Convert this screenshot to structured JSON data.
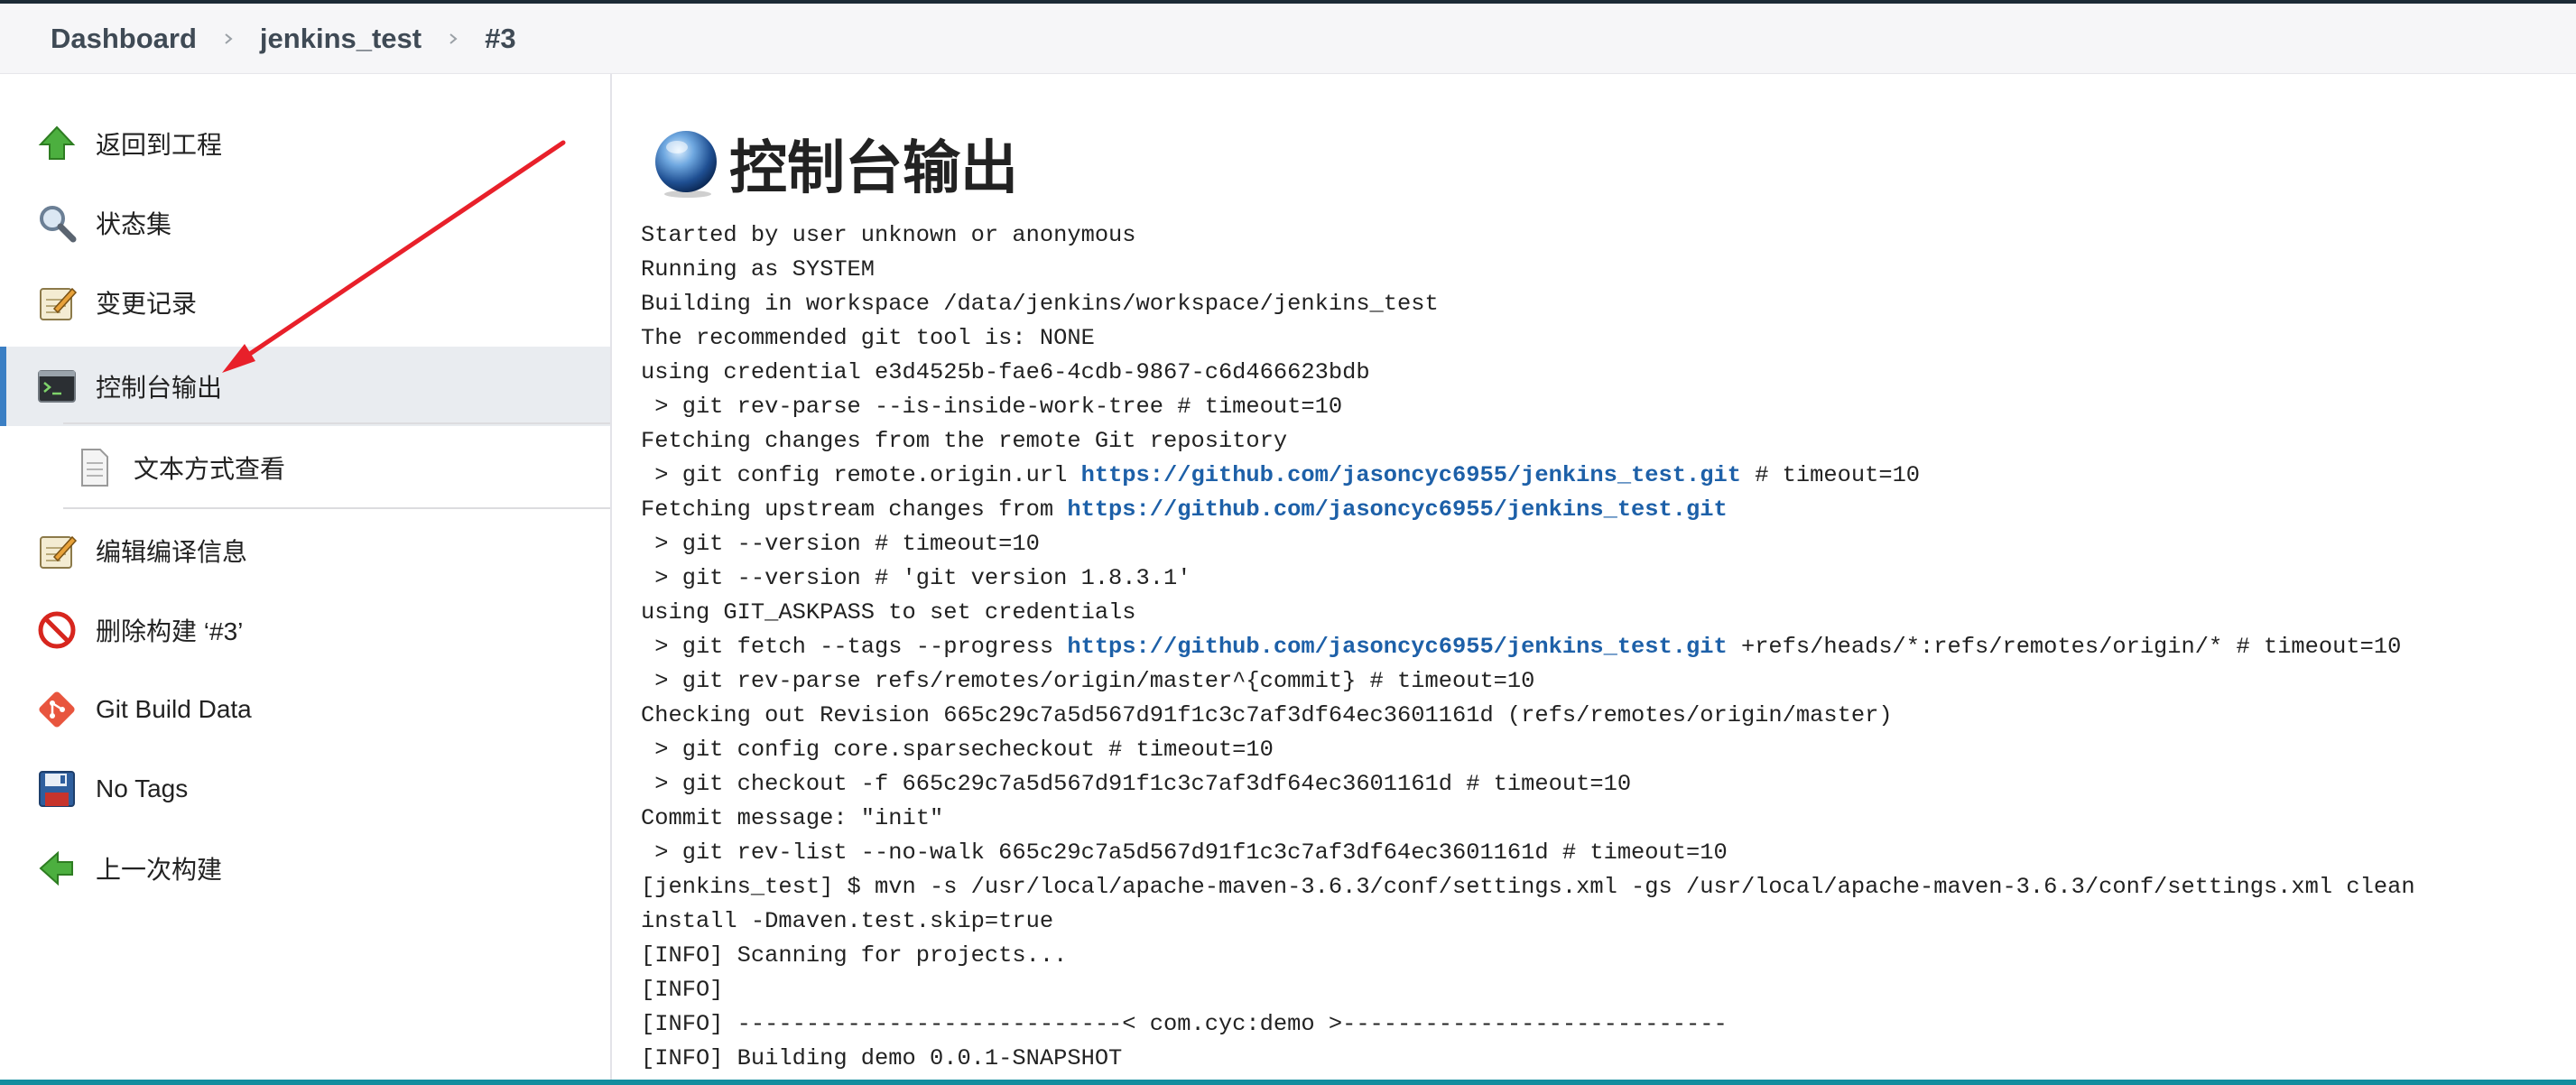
{
  "breadcrumb": {
    "items": [
      "Dashboard",
      "jenkins_test",
      "#3"
    ]
  },
  "sidebar": {
    "items": [
      {
        "label": "返回到工程",
        "icon": "up-arrow-icon"
      },
      {
        "label": "状态集",
        "icon": "magnifier-icon"
      },
      {
        "label": "变更记录",
        "icon": "notepad-icon"
      },
      {
        "label": "控制台输出",
        "icon": "terminal-icon",
        "active": true
      },
      {
        "label": "文本方式查看",
        "icon": "document-icon"
      },
      {
        "label": "编辑编译信息",
        "icon": "notepad-icon"
      },
      {
        "label": "删除构建 ‘#3’",
        "icon": "no-entry-icon"
      },
      {
        "label": "Git Build Data",
        "icon": "git-icon"
      },
      {
        "label": "No Tags",
        "icon": "floppy-icon"
      },
      {
        "label": "上一次构建",
        "icon": "left-arrow-icon"
      }
    ]
  },
  "main": {
    "title": "控制台输出",
    "console_lines": [
      [
        {
          "t": "Started by user unknown or anonymous"
        }
      ],
      [
        {
          "t": "Running as SYSTEM"
        }
      ],
      [
        {
          "t": "Building in workspace /data/jenkins/workspace/jenkins_test"
        }
      ],
      [
        {
          "t": "The recommended git tool is: NONE"
        }
      ],
      [
        {
          "t": "using credential e3d4525b-fae6-4cdb-9867-c6d466623bdb"
        }
      ],
      [
        {
          "t": " > git rev-parse --is-inside-work-tree # timeout=10"
        }
      ],
      [
        {
          "t": "Fetching changes from the remote Git repository"
        }
      ],
      [
        {
          "t": " > git config remote.origin.url "
        },
        {
          "t": "https://github.com/jasoncyc6955/jenkins_test.git",
          "link": true
        },
        {
          "t": " # timeout=10"
        }
      ],
      [
        {
          "t": "Fetching upstream changes from "
        },
        {
          "t": "https://github.com/jasoncyc6955/jenkins_test.git",
          "link": true
        }
      ],
      [
        {
          "t": " > git --version # timeout=10"
        }
      ],
      [
        {
          "t": " > git --version # 'git version 1.8.3.1'"
        }
      ],
      [
        {
          "t": "using GIT_ASKPASS to set credentials"
        }
      ],
      [
        {
          "t": " > git fetch --tags --progress "
        },
        {
          "t": "https://github.com/jasoncyc6955/jenkins_test.git",
          "link": true
        },
        {
          "t": " +refs/heads/*:refs/remotes/origin/* # timeout=10"
        }
      ],
      [
        {
          "t": " > git rev-parse refs/remotes/origin/master^{commit} # timeout=10"
        }
      ],
      [
        {
          "t": "Checking out Revision 665c29c7a5d567d91f1c3c7af3df64ec3601161d (refs/remotes/origin/master)"
        }
      ],
      [
        {
          "t": " > git config core.sparsecheckout # timeout=10"
        }
      ],
      [
        {
          "t": " > git checkout -f 665c29c7a5d567d91f1c3c7af3df64ec3601161d # timeout=10"
        }
      ],
      [
        {
          "t": "Commit message: \"init\""
        }
      ],
      [
        {
          "t": " > git rev-list --no-walk 665c29c7a5d567d91f1c3c7af3df64ec3601161d # timeout=10"
        }
      ],
      [
        {
          "t": "[jenkins_test] $ mvn -s /usr/local/apache-maven-3.6.3/conf/settings.xml -gs /usr/local/apache-maven-3.6.3/conf/settings.xml clean"
        }
      ],
      [
        {
          "t": "install -Dmaven.test.skip=true"
        }
      ],
      [
        {
          "t": "[INFO] Scanning for projects..."
        }
      ],
      [
        {
          "t": "[INFO]"
        }
      ],
      [
        {
          "t": "[INFO] ----------------------------< com.cyc:demo >----------------------------"
        }
      ],
      [
        {
          "t": "[INFO] Building demo 0.0.1-SNAPSHOT"
        }
      ]
    ]
  },
  "colors": {
    "accent": "#3b7fc4",
    "link": "#1d60a8",
    "active_bg": "#e9ecf0",
    "annotation_arrow": "#e8202a"
  }
}
